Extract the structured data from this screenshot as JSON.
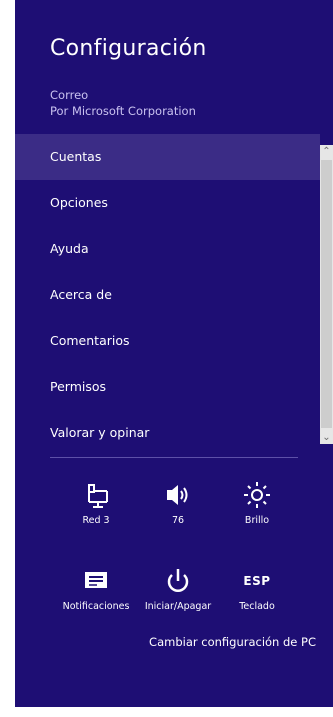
{
  "header": {
    "title": "Configuración",
    "app_name": "Correo",
    "publisher": "Por Microsoft Corporation"
  },
  "menu": {
    "items": [
      {
        "label": "Cuentas",
        "selected": true
      },
      {
        "label": "Opciones",
        "selected": false
      },
      {
        "label": "Ayuda",
        "selected": false
      },
      {
        "label": "Acerca de",
        "selected": false
      },
      {
        "label": "Comentarios",
        "selected": false
      },
      {
        "label": "Permisos",
        "selected": false
      },
      {
        "label": "Valorar y opinar",
        "selected": false
      }
    ]
  },
  "quick_settings": {
    "network": {
      "label": "Red 3",
      "icon": "network-icon"
    },
    "volume": {
      "label": "76",
      "icon": "speaker-icon"
    },
    "brightness": {
      "label": "Brillo",
      "icon": "brightness-icon"
    },
    "notifications": {
      "label": "Notificaciones",
      "icon": "notifications-icon"
    },
    "power": {
      "label": "Iniciar/Apagar",
      "icon": "power-icon"
    },
    "keyboard": {
      "value": "ESP",
      "label": "Teclado"
    }
  },
  "footer": {
    "change_settings": "Cambiar configuración de PC"
  },
  "colors": {
    "pane_background": "#1e0e74",
    "selected_item": "#3b2c86",
    "text": "#ffffff"
  }
}
